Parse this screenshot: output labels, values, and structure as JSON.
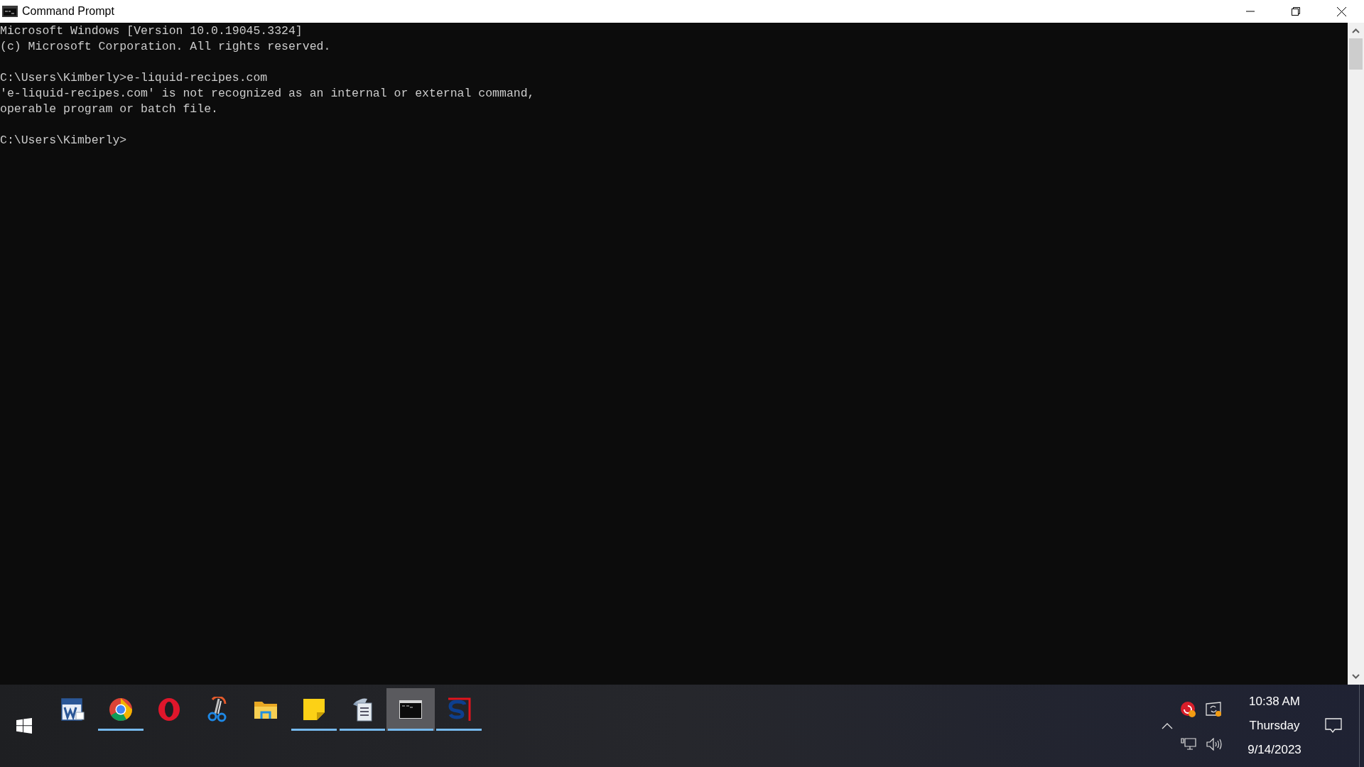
{
  "window": {
    "title": "Command Prompt"
  },
  "console": {
    "blocks": [
      [
        "Microsoft Windows [Version 10.0.19045.3324]",
        "(c) Microsoft Corporation. All rights reserved."
      ],
      [
        "C:\\Users\\Kimberly>e-liquid-recipes.com",
        "'e-liquid-recipes.com' is not recognized as an internal or external command,",
        "operable program or batch file."
      ],
      [
        "C:\\Users\\Kimberly>"
      ]
    ]
  },
  "taskbar": {
    "apps": [
      {
        "kind": "word",
        "running": false,
        "selected": false
      },
      {
        "kind": "chrome",
        "running": true,
        "selected": false
      },
      {
        "kind": "opera",
        "running": false,
        "selected": false
      },
      {
        "kind": "scissors",
        "running": false,
        "selected": false
      },
      {
        "kind": "folder",
        "running": false,
        "selected": false
      },
      {
        "kind": "notes",
        "running": true,
        "selected": false
      },
      {
        "kind": "document",
        "running": true,
        "selected": false
      },
      {
        "kind": "terminal",
        "running": true,
        "selected": true
      },
      {
        "kind": "slogo",
        "running": true,
        "selected": false
      }
    ],
    "clock": {
      "time": "10:38 AM",
      "day": "Thursday",
      "date": "9/14/2023"
    }
  }
}
